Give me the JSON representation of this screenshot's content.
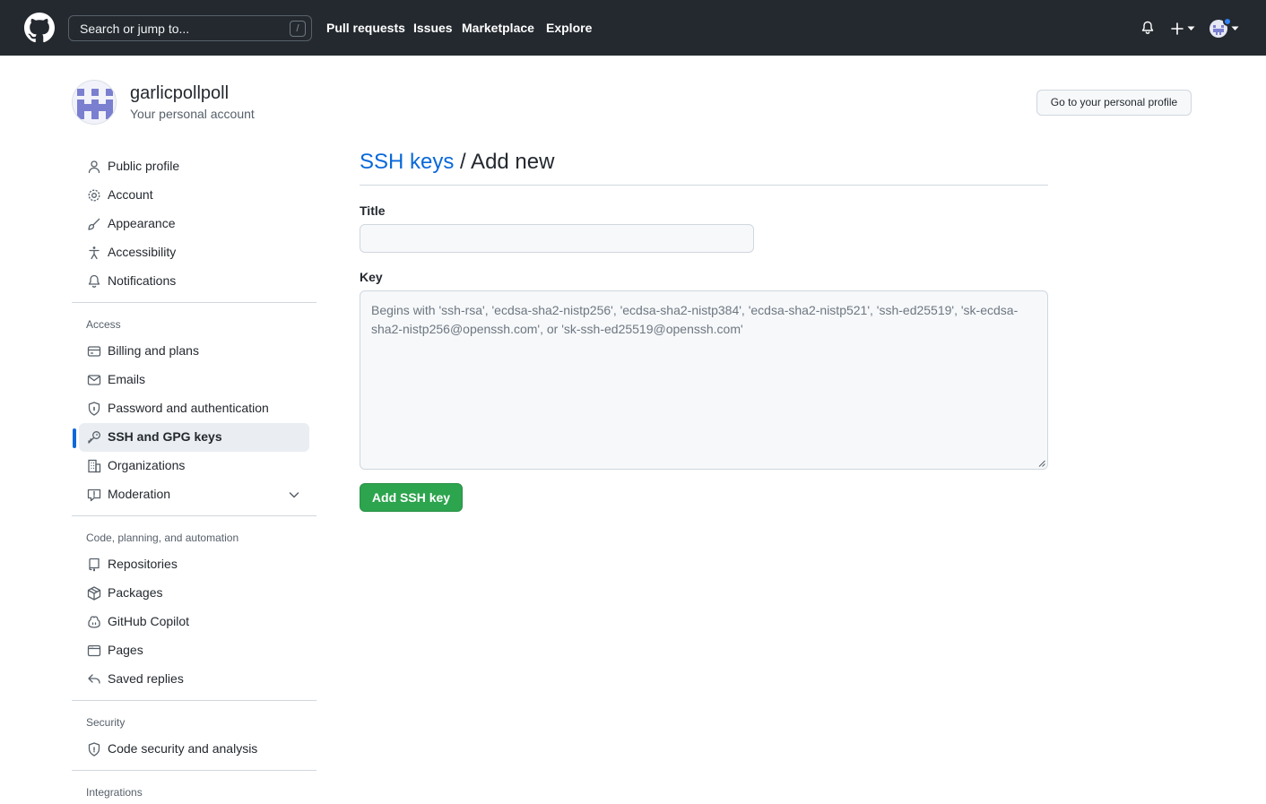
{
  "header": {
    "search_placeholder": "Search or jump to...",
    "search_shortcut": "/",
    "nav": [
      "Pull requests",
      "Issues",
      "Marketplace",
      "Explore"
    ],
    "notification_dot_color": "#2f81f7"
  },
  "profile": {
    "username": "garlicpollpoll",
    "subtitle": "Your personal account",
    "profile_button": "Go to your personal profile"
  },
  "sidebar": {
    "items": [
      {
        "label": "Public profile",
        "icon": "person-icon"
      },
      {
        "label": "Account",
        "icon": "gear-icon"
      },
      {
        "label": "Appearance",
        "icon": "paintbrush-icon"
      },
      {
        "label": "Accessibility",
        "icon": "accessibility-icon"
      },
      {
        "label": "Notifications",
        "icon": "bell-icon"
      }
    ],
    "access_heading": "Access",
    "access_items": [
      {
        "label": "Billing and plans",
        "icon": "credit-card-icon"
      },
      {
        "label": "Emails",
        "icon": "mail-icon"
      },
      {
        "label": "Password and authentication",
        "icon": "shield-lock-icon"
      },
      {
        "label": "SSH and GPG keys",
        "icon": "key-icon",
        "active": true
      },
      {
        "label": "Organizations",
        "icon": "organization-icon"
      },
      {
        "label": "Moderation",
        "icon": "report-icon"
      }
    ],
    "code_heading": "Code, planning, and automation",
    "code_items": [
      {
        "label": "Repositories",
        "icon": "repo-icon"
      },
      {
        "label": "Packages",
        "icon": "package-icon"
      },
      {
        "label": "GitHub Copilot",
        "icon": "copilot-icon"
      },
      {
        "label": "Pages",
        "icon": "browser-icon"
      },
      {
        "label": "Saved replies",
        "icon": "reply-icon"
      }
    ],
    "security_heading": "Security",
    "security_items": [
      {
        "label": "Code security and analysis",
        "icon": "shield-icon"
      }
    ],
    "integrations_heading": "Integrations"
  },
  "main": {
    "breadcrumb_link": "SSH keys",
    "breadcrumb_current": " / Add new",
    "title_label": "Title",
    "title_value": "",
    "key_label": "Key",
    "key_placeholder": "Begins with 'ssh-rsa', 'ecdsa-sha2-nistp256', 'ecdsa-sha2-nistp384', 'ecdsa-sha2-nistp521', 'ssh-ed25519', 'sk-ecdsa-sha2-nistp256@openssh.com', or 'sk-ssh-ed25519@openssh.com'",
    "submit_label": "Add SSH key"
  },
  "colors": {
    "header_bg": "#24292f",
    "link": "#0969da",
    "primary_button": "#2da44e",
    "active_indicator": "#0969da"
  }
}
